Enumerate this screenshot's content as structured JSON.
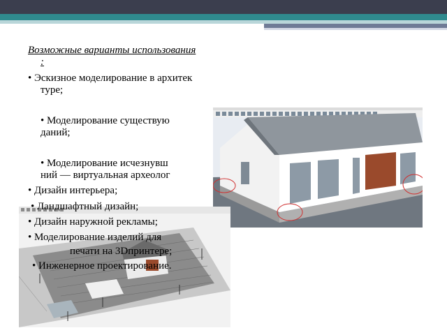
{
  "slide": {
    "heading_line1": "Возможные варианты использования",
    "heading_line2": ":",
    "bullets": {
      "b1_line1": "• Эскизное моделирование в архитек",
      "b1_line2": "туре;",
      "b2_line1": "• Моделирование существую",
      "b2_line2": "даний;",
      "b3_line1": "• Моделирование исчезнувш",
      "b3_line2": "ний —  виртуальная археолог",
      "b4": "• Дизайн интерьера;",
      "b5": "• Ландшафтный дизайн;",
      "b6": "• Дизайн наружной рекламы;",
      "b7_line1": "• Моделирование изделий для",
      "b7_line2": "печати на 3Dпринтере;",
      "b8": "• Инженерное проектирование."
    }
  },
  "images": {
    "house_screenshot": {
      "icon": "sketchup-house-model",
      "accent": "#9a4a2c"
    },
    "yard_screenshot": {
      "icon": "sketchup-landscape-model"
    }
  },
  "theme": {
    "topbar": "#3b3e4e",
    "teal": "#2f8a8e",
    "slate": "#6f7b96"
  }
}
